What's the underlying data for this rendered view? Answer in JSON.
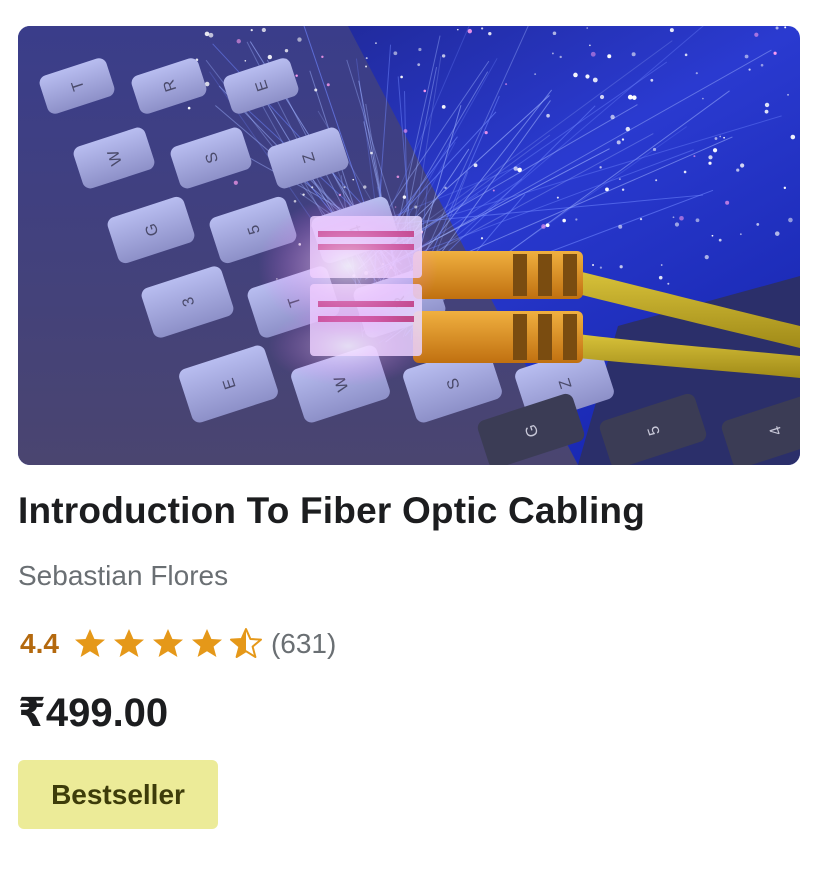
{
  "course": {
    "thumbnail_alt": "fiber-optic-cables-on-keyboard-image",
    "title": "Introduction To Fiber Optic Cabling",
    "instructor": "Sebastian Flores",
    "rating": 4.4,
    "rating_text": "4.4",
    "stars_total": 5,
    "review_count_text": "(631)",
    "price": "₹499.00",
    "badge": "Bestseller"
  },
  "colors": {
    "title": "#1c1d1f",
    "muted": "#6a6f73",
    "rating": "#b4690e",
    "star": "#e59819",
    "badge_bg": "#eceb98",
    "badge_text": "#3d3c0a"
  },
  "thumbnail_key_letters": [
    "T",
    "R",
    "E",
    "W",
    "S",
    "Z",
    "G",
    "5",
    "4",
    "3"
  ]
}
